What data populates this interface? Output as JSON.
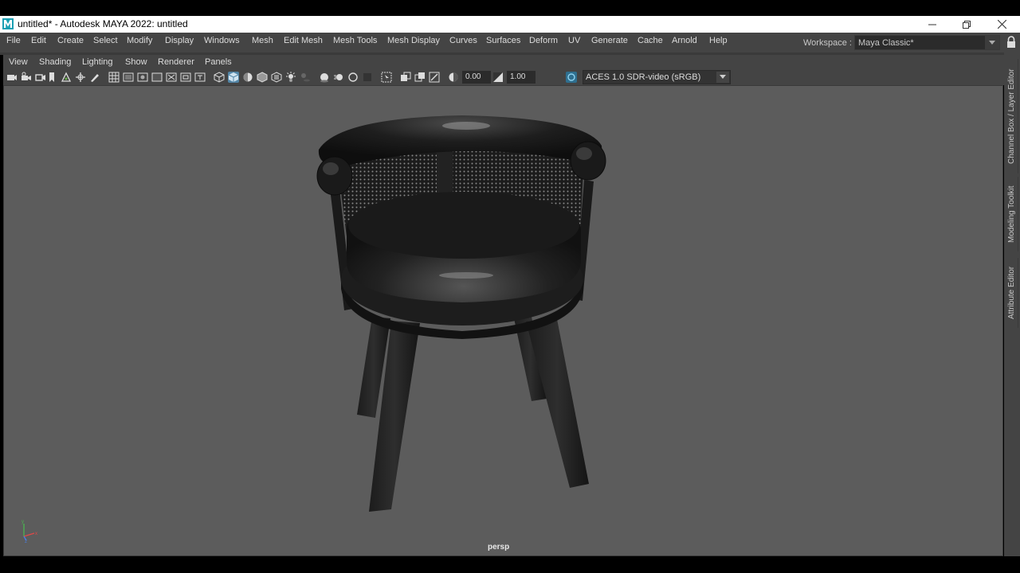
{
  "window": {
    "title": "untitled* - Autodesk MAYA 2022: untitled",
    "minimize_glyph": "—",
    "restore_glyph": "❐",
    "close_glyph": "✕"
  },
  "menubar": {
    "items": [
      "File",
      "Edit",
      "Create",
      "Select",
      "Modify",
      "Display",
      "Windows",
      "Mesh",
      "Edit Mesh",
      "Mesh Tools",
      "Mesh Display",
      "Curves",
      "Surfaces",
      "Deform",
      "UV",
      "Generate",
      "Cache",
      "Arnold",
      "Help"
    ],
    "workspace_label": "Workspace :",
    "workspace_value": "Maya Classic*"
  },
  "panel_menu": {
    "items": [
      "View",
      "Shading",
      "Lighting",
      "Show",
      "Renderer",
      "Panels"
    ]
  },
  "toolbar": {
    "exposure": "0.00",
    "gamma": "1.00",
    "color_space": "ACES 1.0 SDR-video (sRGB)"
  },
  "viewport": {
    "camera": "persp",
    "background_color": "#5c5c5c",
    "accent_color": "#5285a6"
  },
  "right_dock": {
    "tabs": [
      "Channel Box / Layer Editor",
      "Modeling Toolkit",
      "Attribute Editor"
    ]
  }
}
